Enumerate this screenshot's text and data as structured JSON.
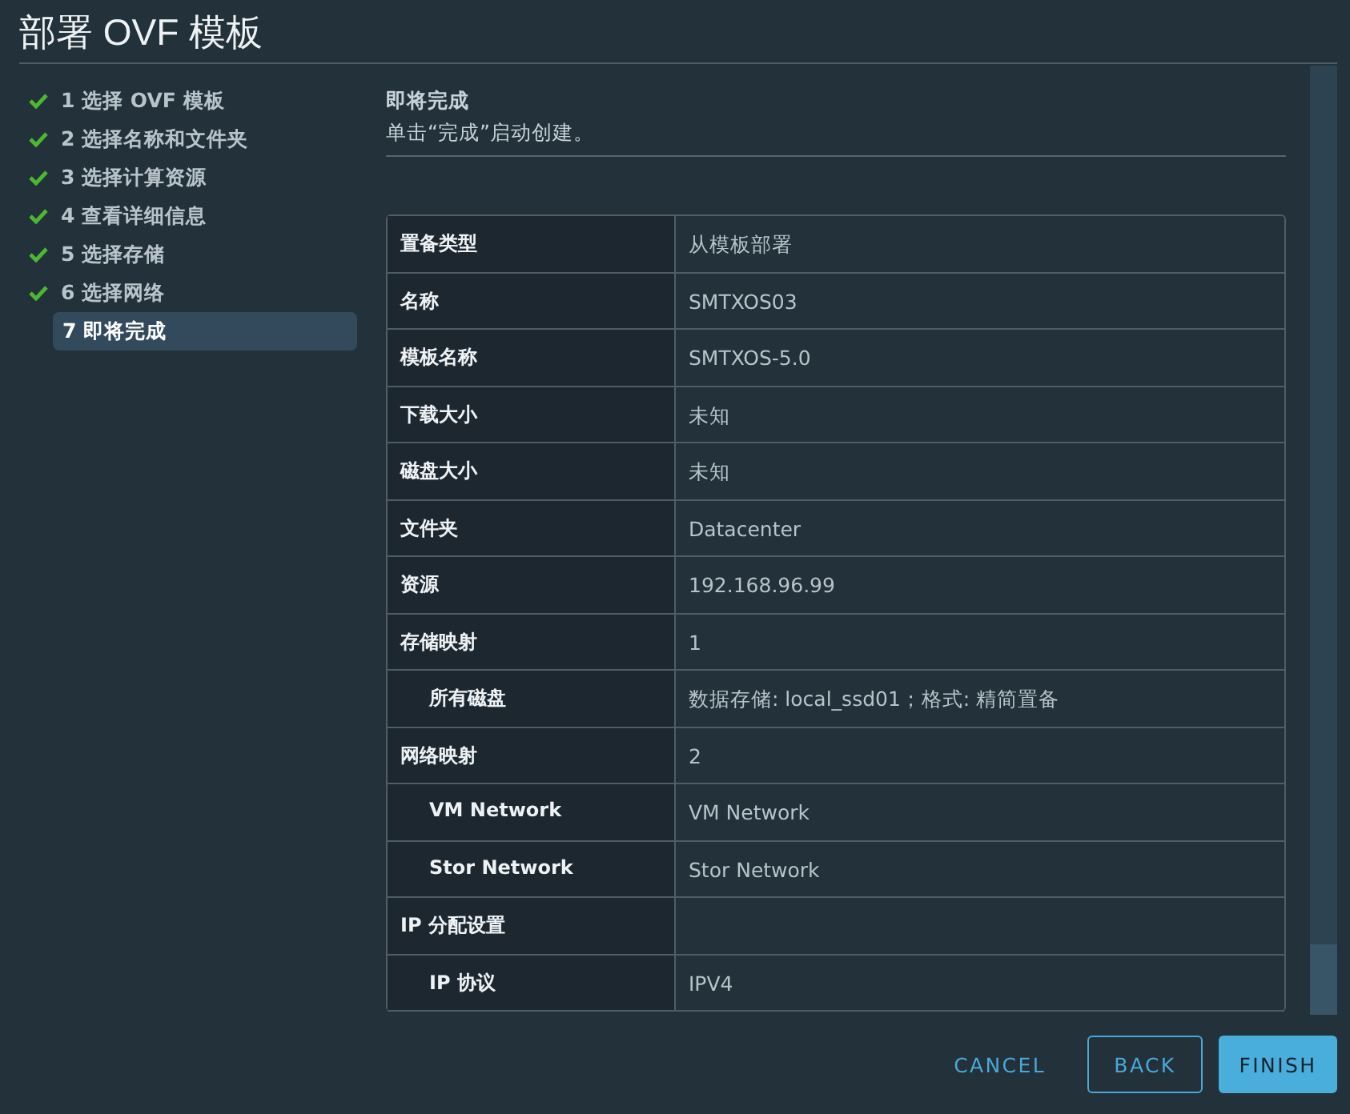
{
  "window": {
    "title": "部署 OVF 模板"
  },
  "steps": [
    {
      "label": "1 选择 OVF 模板",
      "done": true,
      "selected": false
    },
    {
      "label": "2 选择名称和文件夹",
      "done": true,
      "selected": false
    },
    {
      "label": "3 选择计算资源",
      "done": true,
      "selected": false
    },
    {
      "label": "4 查看详细信息",
      "done": true,
      "selected": false
    },
    {
      "label": "5 选择存储",
      "done": true,
      "selected": false
    },
    {
      "label": "6 选择网络",
      "done": true,
      "selected": false
    },
    {
      "label": "7 即将完成",
      "done": false,
      "selected": true
    }
  ],
  "section": {
    "heading": "即将完成",
    "description": "单击“完成”启动创建。"
  },
  "table": {
    "rows": [
      {
        "label": "置备类型",
        "value": "从模板部署"
      },
      {
        "label": "名称",
        "value": "SMTXOS03"
      },
      {
        "label": "模板名称",
        "value": "SMTXOS-5.0"
      },
      {
        "label": "下载大小",
        "value": "未知"
      },
      {
        "label": "磁盘大小",
        "value": "未知"
      },
      {
        "label": "文件夹",
        "value": "Datacenter"
      },
      {
        "label": "资源",
        "value": "192.168.96.99"
      },
      {
        "label": "存储映射",
        "value": "1",
        "children": [
          {
            "label": "所有磁盘",
            "value": "数据存储: local_ssd01；格式: 精简置备"
          }
        ]
      },
      {
        "label": "网络映射",
        "value": "2",
        "children": [
          {
            "label": "VM Network",
            "value": "VM Network"
          },
          {
            "label": "Stor Network",
            "value": "Stor Network"
          }
        ]
      },
      {
        "label": "IP 分配设置",
        "children": [
          {
            "label": "IP 协议",
            "value": "IPV4"
          }
        ]
      }
    ]
  },
  "buttons": [
    {
      "label": "CANCEL",
      "kind": "flat"
    },
    {
      "label": "BACK",
      "kind": "outline"
    },
    {
      "label": "FINISH",
      "kind": "primary"
    }
  ]
}
